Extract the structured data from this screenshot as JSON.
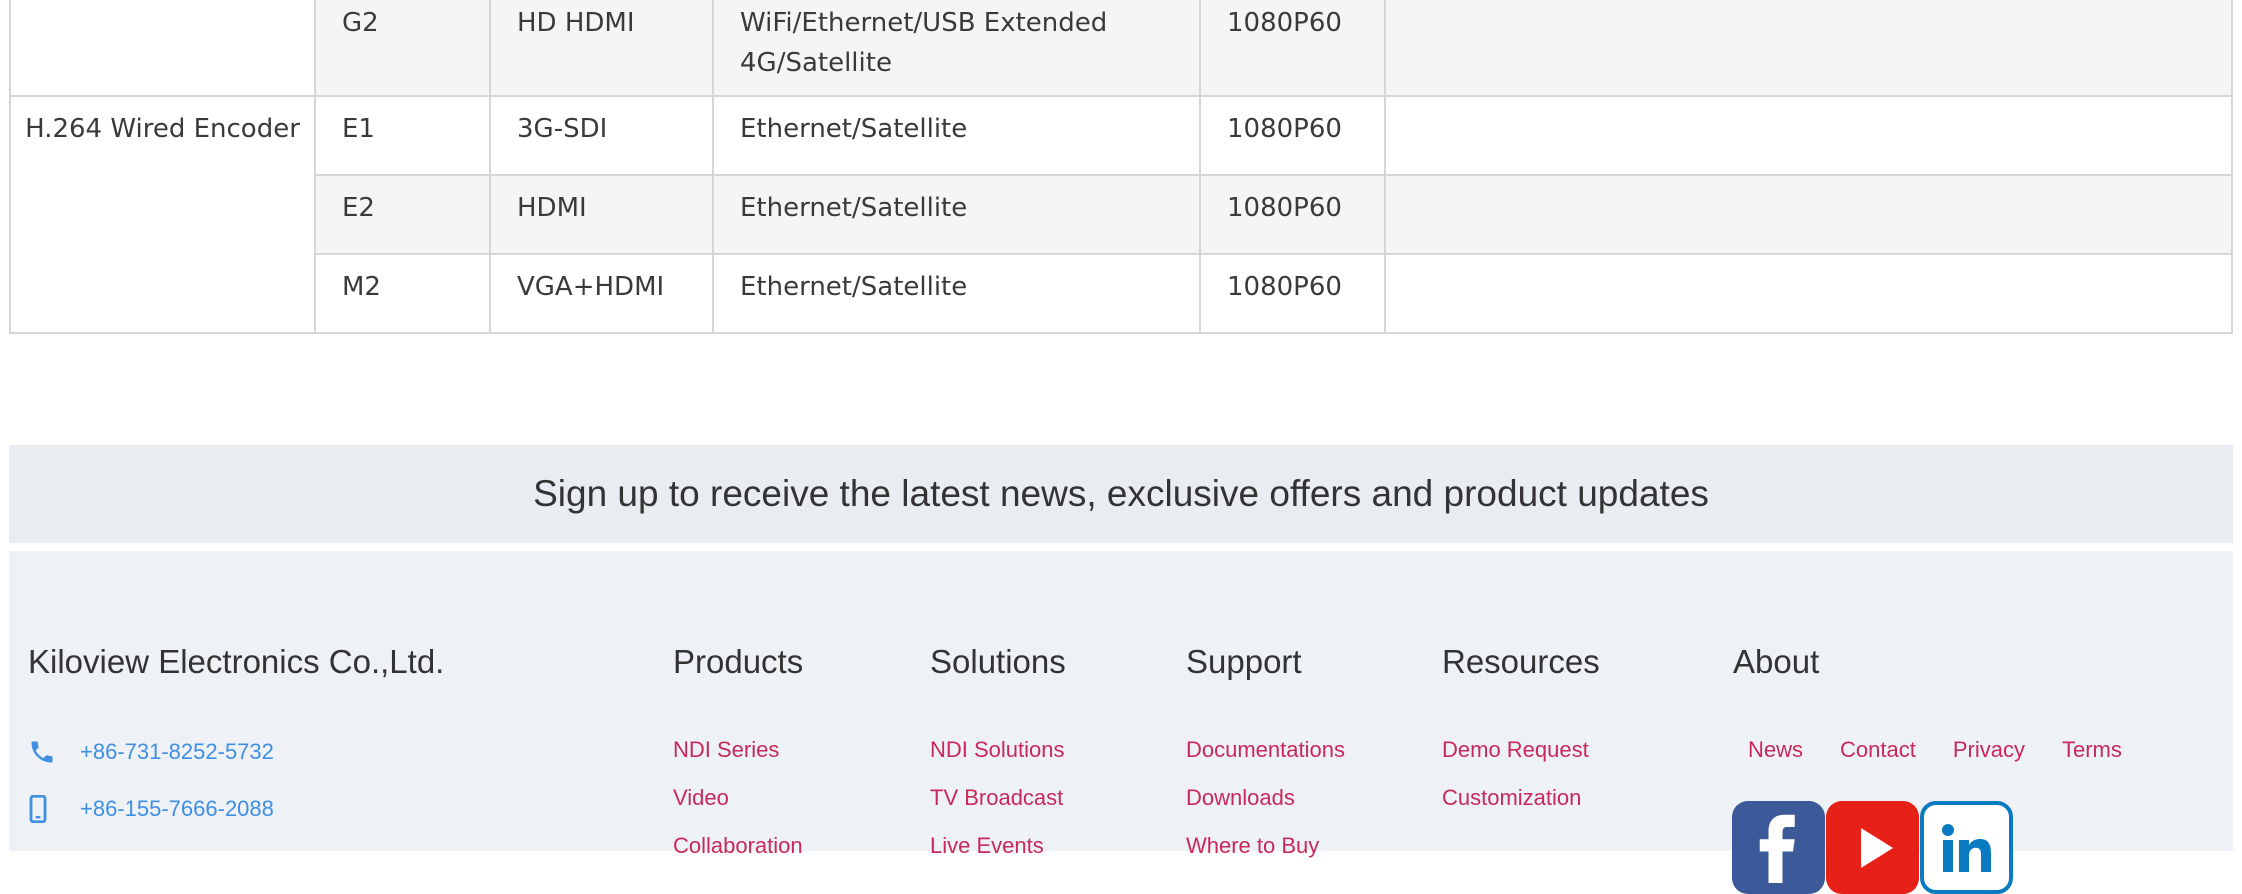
{
  "table": {
    "rows": [
      {
        "group": "",
        "model": "G2",
        "input": "HD HDMI",
        "network_line1": "WiFi/Ethernet/USB Extended",
        "network_line2": "4G/Satellite",
        "resolution": "1080P60",
        "notes": ""
      },
      {
        "group": "H.264 Wired Encoder",
        "model": "E1",
        "input": "3G-SDI",
        "network_line1": "Ethernet/Satellite",
        "network_line2": "",
        "resolution": "1080P60",
        "notes": ""
      },
      {
        "group": "",
        "model": "E2",
        "input": "HDMI",
        "network_line1": "Ethernet/Satellite",
        "network_line2": "",
        "resolution": "1080P60",
        "notes": ""
      },
      {
        "group": "",
        "model": "M2",
        "input": "VGA+HDMI",
        "network_line1": "Ethernet/Satellite",
        "network_line2": "",
        "resolution": "1080P60",
        "notes": ""
      }
    ]
  },
  "signup": {
    "text": "Sign up to receive the latest news, exclusive offers and product updates"
  },
  "footer": {
    "company": "Kiloview Electronics Co.,Ltd.",
    "phone": "+86-731-8252-5732",
    "mobile": "+86-155-7666-2088",
    "columns": [
      {
        "title": "Products",
        "links": [
          "NDI Series",
          "Video",
          "Collaboration"
        ]
      },
      {
        "title": "Solutions",
        "links": [
          "NDI Solutions",
          "TV Broadcast",
          "Live Events"
        ]
      },
      {
        "title": "Support",
        "links": [
          "Documentations",
          "Downloads",
          "Where to Buy"
        ]
      },
      {
        "title": "Resources",
        "links": [
          "Demo Request",
          "Customization"
        ]
      }
    ],
    "about": {
      "title": "About",
      "links": [
        "News",
        "Contact",
        "Privacy",
        "Terms"
      ]
    },
    "social": [
      "facebook-icon",
      "youtube-icon",
      "linkedin-icon"
    ],
    "colors": {
      "link": "#c8295a",
      "contact": "#3f8fe3",
      "band": "#e9edf2",
      "footer_bg": "#eef1f6"
    }
  }
}
